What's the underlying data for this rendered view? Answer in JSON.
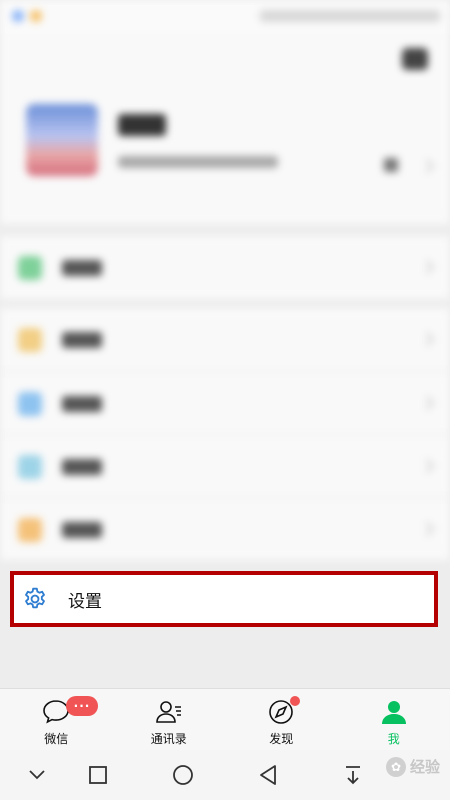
{
  "settings": {
    "label": "设置"
  },
  "tabs": [
    {
      "label": "微信",
      "icon": "chat-bubble-icon",
      "badge": "···"
    },
    {
      "label": "通讯录",
      "icon": "contacts-icon"
    },
    {
      "label": "发现",
      "icon": "compass-icon"
    },
    {
      "label": "我",
      "icon": "person-icon",
      "active": true
    }
  ],
  "watermark": {
    "text": "经验"
  },
  "colors": {
    "accent_green": "#07c160",
    "badge_red": "#f05454",
    "highlight_border": "#b40000",
    "settings_icon_blue": "#2e7dd1"
  }
}
